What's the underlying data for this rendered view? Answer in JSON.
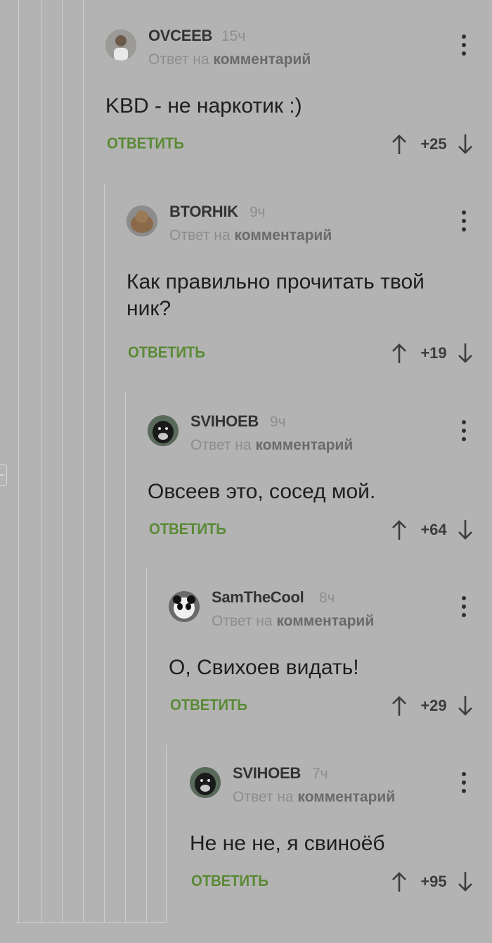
{
  "colors": {
    "background": "#b3b3b3",
    "reply_button": "#5a8a36",
    "text": "#1e1e1e",
    "muted": "#8d8d8d"
  },
  "comments": [
    {
      "author": "OVCEEB",
      "time": "15ч",
      "reply_prefix": "Ответ на",
      "reply_target": "комментарий",
      "text": "KBD - не наркотик :)",
      "reply_label": "ОТВЕТИТЬ",
      "score": "+25",
      "avatar": "avatar-person-icon"
    },
    {
      "author": "BTORHIK",
      "time": "9ч",
      "reply_prefix": "Ответ на",
      "reply_target": "комментарий",
      "text": "Как правильно прочитать твой ник?",
      "reply_label": "ОТВЕТИТЬ",
      "score": "+19",
      "avatar": "avatar-animal-icon"
    },
    {
      "author": "SVIHOEB",
      "time": "9ч",
      "reply_prefix": "Ответ на",
      "reply_target": "комментарий",
      "text": "Овсеев это, сосед мой.",
      "reply_label": "ОТВЕТИТЬ",
      "score": "+64",
      "avatar": "avatar-gorilla-icon"
    },
    {
      "author": "SamTheCool",
      "time": "8ч",
      "reply_prefix": "Ответ на",
      "reply_target": "комментарий",
      "text": "О, Свихоев видать!",
      "reply_label": "ОТВЕТИТЬ",
      "score": "+29",
      "avatar": "avatar-panda-icon"
    },
    {
      "author": "SVIHOEB",
      "time": "7ч",
      "reply_prefix": "Ответ на",
      "reply_target": "комментарий",
      "text": "Не не не, я свиноёб",
      "reply_label": "ОТВЕТИТЬ",
      "score": "+95",
      "avatar": "avatar-gorilla-icon"
    }
  ]
}
